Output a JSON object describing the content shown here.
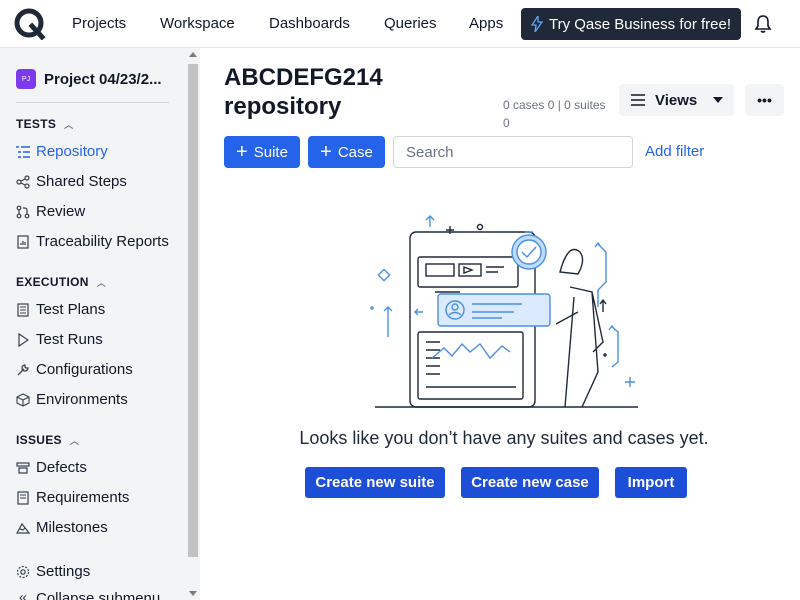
{
  "nav": {
    "items": [
      "Projects",
      "Workspace",
      "Dashboards",
      "Queries",
      "Apps"
    ],
    "promo_label": "Try Qase Business for free!"
  },
  "sidebar": {
    "project_badge": "PJ",
    "project_name": "Project 04/23/2...",
    "sections": [
      {
        "title": "TESTS",
        "items": [
          "Repository",
          "Shared Steps",
          "Review",
          "Traceability Reports"
        ]
      },
      {
        "title": "EXECUTION",
        "items": [
          "Test Plans",
          "Test Runs",
          "Configurations",
          "Environments"
        ]
      },
      {
        "title": "ISSUES",
        "items": [
          "Defects",
          "Requirements",
          "Milestones"
        ]
      }
    ],
    "settings_label": "Settings",
    "collapse_label": "Collapse submenu"
  },
  "main": {
    "title": "ABCDEFG214 repository",
    "counts": "0 cases 0 | 0 suites 0",
    "views_label": "Views",
    "more_label": "•••",
    "suite_label": "Suite",
    "case_label": "Case",
    "search_placeholder": "Search",
    "add_filter_label": "Add filter",
    "empty_message": "Looks like you don’t have any suites and cases yet.",
    "create_suite_label": "Create new suite",
    "create_case_label": "Create new case",
    "import_label": "Import"
  },
  "colors": {
    "accent": "#2563eb",
    "cta": "#1d4ed8",
    "promo_bg": "#1f2937",
    "sidebar_bg": "#f3f4f6",
    "project_badge": "#7c3aed"
  }
}
